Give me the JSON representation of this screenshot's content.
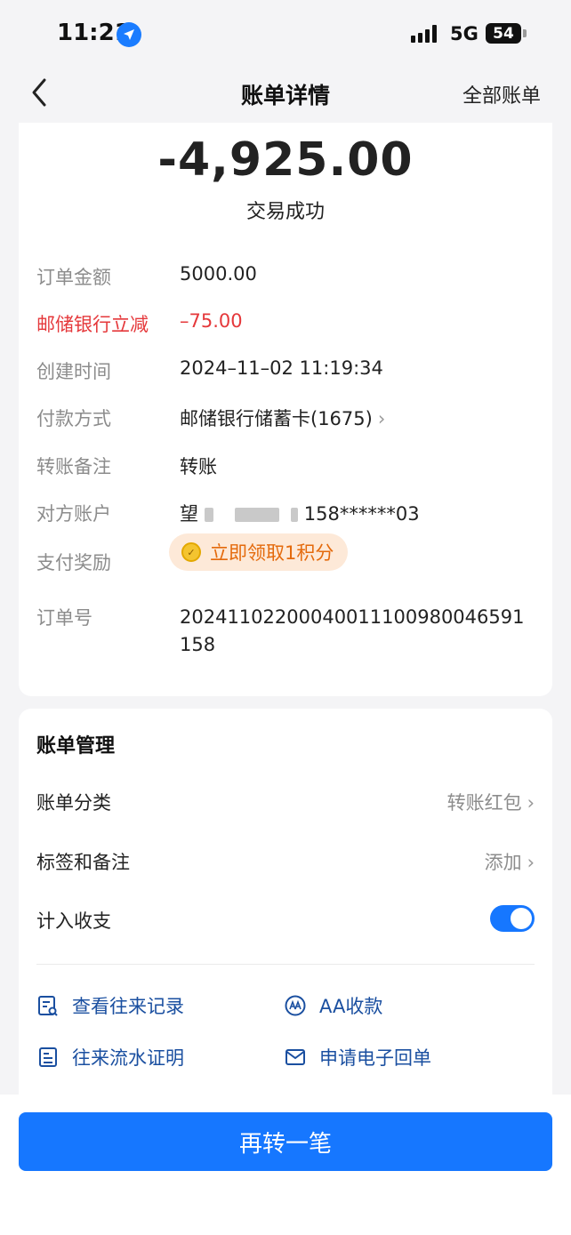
{
  "status_bar": {
    "time": "11:21",
    "network": "5G",
    "battery": "54"
  },
  "nav": {
    "title": "账单详情",
    "right_link": "全部账单"
  },
  "summary": {
    "amount": "-4,925.00",
    "status": "交易成功"
  },
  "details": {
    "order_amount_label": "订单金额",
    "order_amount": "5000.00",
    "discount_label": "邮储银行立减",
    "discount": "–75.00",
    "created_label": "创建时间",
    "created": "2024–11–02 11:19:34",
    "payment_label": "付款方式",
    "payment": "邮储银行储蓄卡(1675)",
    "memo_label": "转账备注",
    "memo": "转账",
    "account_label": "对方账户",
    "account_name_visible": "望",
    "account_number": "158******03",
    "reward_label": "支付奖励",
    "reward": "立即领取1积分",
    "order_no_label": "订单号",
    "order_no": "20241102200040011100980046591158"
  },
  "management": {
    "title": "账单管理",
    "category_label": "账单分类",
    "category_value": "转账红包",
    "tags_label": "标签和备注",
    "tags_value": "添加",
    "count_label": "计入收支",
    "count_enabled": true,
    "actions": {
      "history": "查看往来记录",
      "aa": "AA收款",
      "statement": "往来流水证明",
      "receipt": "申请电子回单"
    }
  },
  "bottom_button": "再转一笔",
  "colors": {
    "primary": "#1677ff",
    "discount_red": "#e5383b",
    "reward_orange": "#e46a0c",
    "reward_bg": "#fde9d8"
  }
}
